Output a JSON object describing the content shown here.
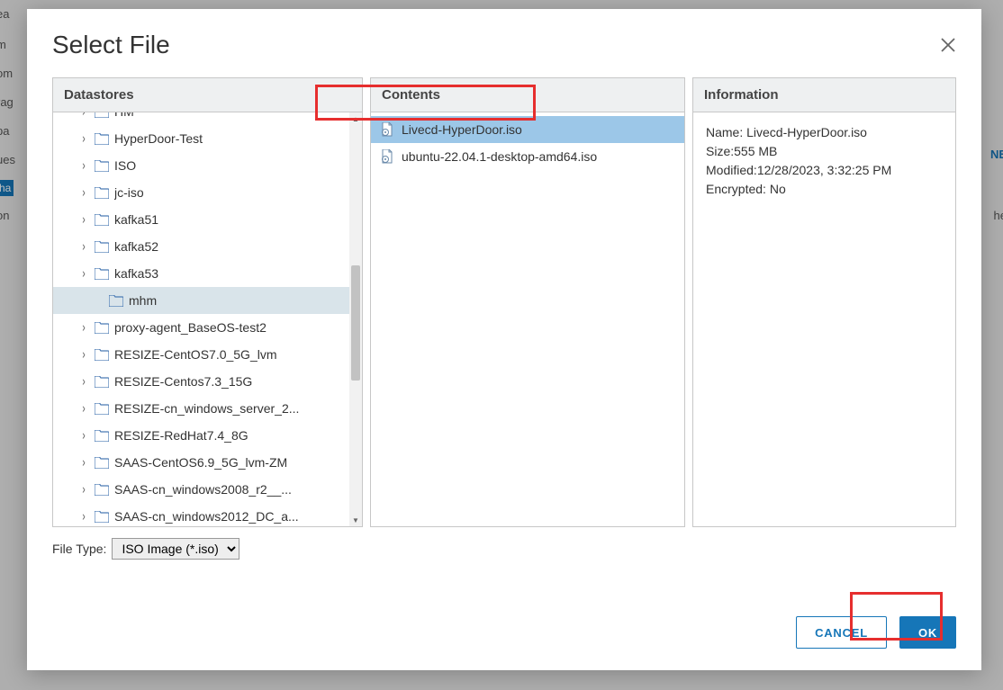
{
  "modal": {
    "title": "Select File",
    "panels": {
      "datastores": "Datastores",
      "contents": "Contents",
      "information": "Information"
    }
  },
  "tree": {
    "items": [
      {
        "label": "HM",
        "expandable": true,
        "selected": false
      },
      {
        "label": "HyperDoor-Test",
        "expandable": true,
        "selected": false
      },
      {
        "label": "ISO",
        "expandable": true,
        "selected": false
      },
      {
        "label": "jc-iso",
        "expandable": true,
        "selected": false
      },
      {
        "label": "kafka51",
        "expandable": true,
        "selected": false
      },
      {
        "label": "kafka52",
        "expandable": true,
        "selected": false
      },
      {
        "label": "kafka53",
        "expandable": true,
        "selected": false
      },
      {
        "label": "mhm",
        "expandable": false,
        "selected": true
      },
      {
        "label": "proxy-agent_BaseOS-test2",
        "expandable": true,
        "selected": false
      },
      {
        "label": "RESIZE-CentOS7.0_5G_lvm",
        "expandable": true,
        "selected": false
      },
      {
        "label": "RESIZE-Centos7.3_15G",
        "expandable": true,
        "selected": false
      },
      {
        "label": "RESIZE-cn_windows_server_2...",
        "expandable": true,
        "selected": false
      },
      {
        "label": "RESIZE-RedHat7.4_8G",
        "expandable": true,
        "selected": false
      },
      {
        "label": "SAAS-CentOS6.9_5G_lvm-ZM",
        "expandable": true,
        "selected": false
      },
      {
        "label": "SAAS-cn_windows2008_r2__...",
        "expandable": true,
        "selected": false
      },
      {
        "label": "SAAS-cn_windows2012_DC_a...",
        "expandable": true,
        "selected": false
      }
    ]
  },
  "contents": {
    "files": [
      {
        "label": "Livecd-HyperDoor.iso",
        "selected": true
      },
      {
        "label": "ubuntu-22.04.1-desktop-amd64.iso",
        "selected": false
      }
    ]
  },
  "info": {
    "name_label": "Name: ",
    "name_value": "Livecd-HyperDoor.iso",
    "size_label": "Size:",
    "size_value": "555 MB",
    "modified_label": "Modified:",
    "modified_value": "12/28/2023, 3:32:25 PM",
    "encrypted_label": "Encrypted: ",
    "encrypted_value": "No"
  },
  "filetype": {
    "label": "File Type:",
    "selected": "ISO Image (*.iso)"
  },
  "buttons": {
    "cancel": "CANCEL",
    "ok": "OK"
  }
}
